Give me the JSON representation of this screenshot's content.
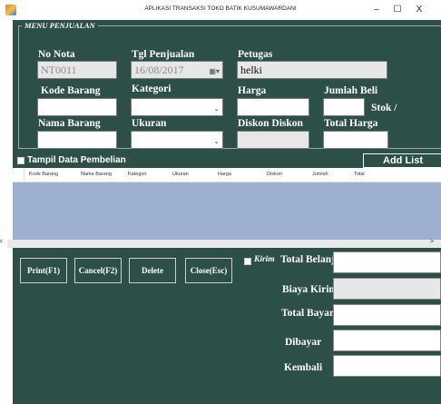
{
  "window": {
    "title": "APLIKASI TRANSAKSI TOKO BATIK KUSUMAWARDANI",
    "minimize": "–",
    "maximize": "☐",
    "close": "X"
  },
  "form": {
    "legend": "MENU PENJUALAN",
    "no_nota": {
      "label": "No Nota",
      "value": "NT0011"
    },
    "tgl_penjualan": {
      "label": "Tgl Penjualan",
      "value": "16/08/2017"
    },
    "petugas": {
      "label": "Petugas",
      "value": "helki"
    },
    "kode_barang": {
      "label": "Kode Barang",
      "value": ""
    },
    "kategori": {
      "label": "Kategori",
      "value": ""
    },
    "harga": {
      "label": "Harga",
      "value": ""
    },
    "jumlah_beli": {
      "label": "Jumlah Beli",
      "value": ""
    },
    "stok": {
      "label": "Stok  /"
    },
    "nama_barang": {
      "label": "Nama Barang",
      "value": ""
    },
    "ukuran": {
      "label": "Ukuran",
      "value": ""
    },
    "diskon": {
      "label": "Diskon  Diskon",
      "value": ""
    },
    "total_harga": {
      "label": "Total Harga",
      "value": ""
    }
  },
  "list": {
    "tampil_label": "Tampil Data Pembelian",
    "add_list": "Add List",
    "columns": [
      "Kode Barang",
      "Nama Barang",
      "Kategori",
      "Ukuran",
      "Harga",
      "Diskon",
      "Jumlah",
      "Total"
    ],
    "rows": [],
    "scroll_left": "<",
    "scroll_right": ">"
  },
  "actions": {
    "print": "Print(F1)",
    "cancel": "Cancel(F2)",
    "delete": "Delete",
    "close": "Close(Esc)"
  },
  "summary": {
    "kirim_label": "Kirim",
    "total_belanja": {
      "label": "Total Belanja",
      "value": ""
    },
    "biaya_kirim": {
      "label": "Biaya Kirim",
      "value": ""
    },
    "total_bayar": {
      "label": "Total Bayar",
      "value": ""
    },
    "dibayar": {
      "label": "Dibayar",
      "value": ""
    },
    "kembali": {
      "label": "Kembali",
      "value": ""
    }
  },
  "colors": {
    "panel": "#2c4f48",
    "grid": "#9db0cf",
    "field_readonly": "#e7e7e7"
  }
}
